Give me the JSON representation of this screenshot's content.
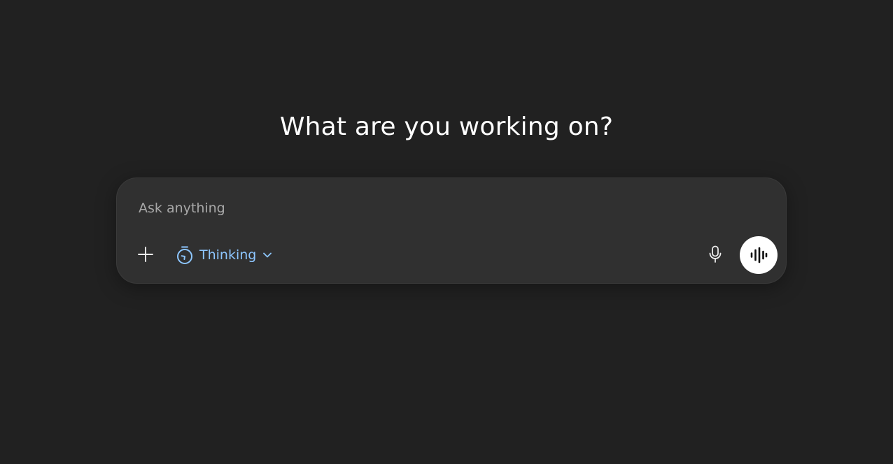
{
  "main": {
    "heading": "What are you working on?"
  },
  "composer": {
    "placeholder": "Ask anything",
    "value": "",
    "add_icon": "plus-icon",
    "mode": {
      "label": "Thinking",
      "icon": "timer-icon",
      "dropdown_icon": "chevron-down-icon"
    },
    "dictate_icon": "microphone-icon",
    "voice_icon": "voice-waveform-icon"
  },
  "colors": {
    "background": "#212121",
    "composer_background": "#303030",
    "accent": "#8dc6ff",
    "heading_text": "#ffffff",
    "placeholder_text": "#a8a8a8",
    "voice_button": "#ffffff"
  }
}
